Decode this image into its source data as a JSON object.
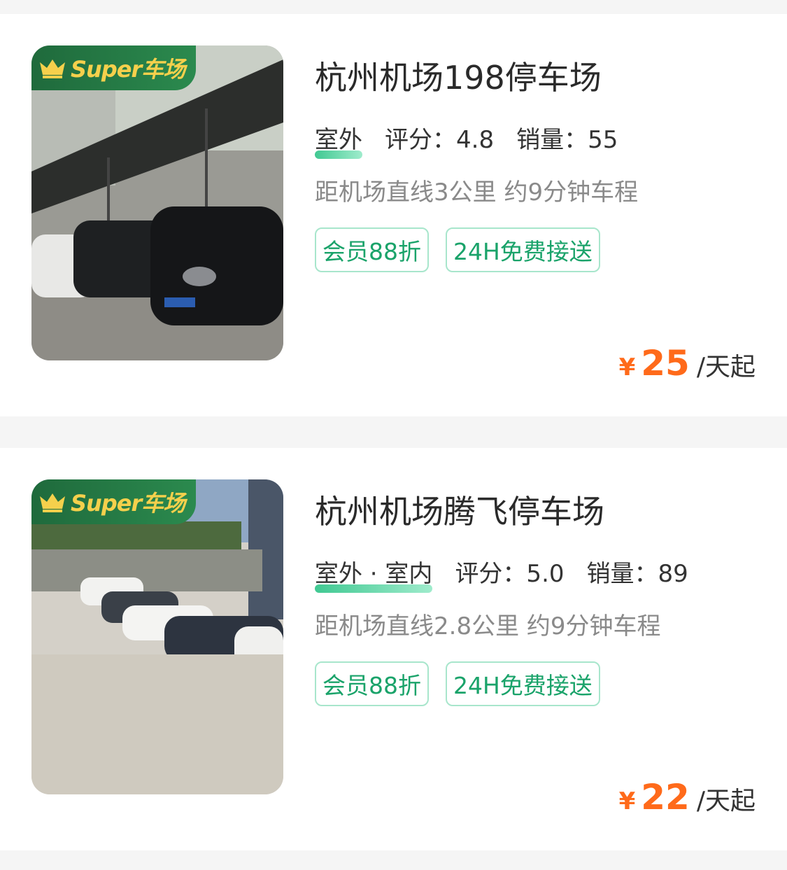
{
  "listings": [
    {
      "badge": "Super车场",
      "title": "杭州机场198停车场",
      "type": "室外",
      "rating_label": "评分：4.8",
      "sales_label": "销量：55",
      "distance": "距机场直线3公里 约9分钟车程",
      "tags": [
        "会员88折",
        "24H免费接送"
      ],
      "currency": "¥",
      "price": "25",
      "unit": "/天起"
    },
    {
      "badge": "Super车场",
      "title": "杭州机场腾飞停车场",
      "type": "室外 · 室内",
      "rating_label": "评分：5.0",
      "sales_label": "销量：89",
      "distance": "距机场直线2.8公里 约9分钟车程",
      "tags": [
        "会员88折",
        "24H免费接送"
      ],
      "currency": "¥",
      "price": "22",
      "unit": "/天起"
    }
  ],
  "colors": {
    "price": "#ff6a1a",
    "tag_text": "#1aa36a",
    "tag_border": "#a8e6cc",
    "badge_bg": "#1f6a3c",
    "badge_text": "#f5d04c"
  }
}
